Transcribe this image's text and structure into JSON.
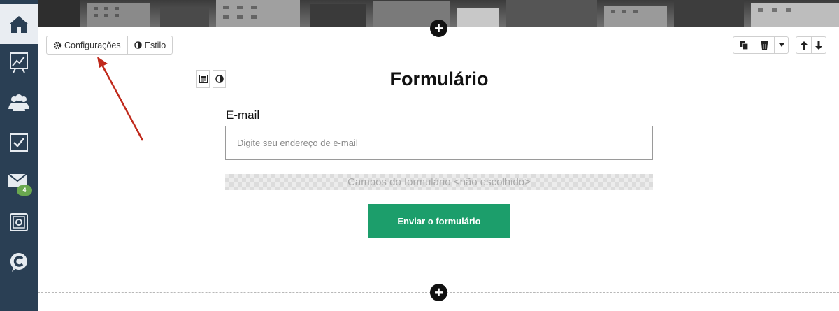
{
  "sidebar": {
    "items": [
      {
        "icon": "home-icon",
        "active": true
      },
      {
        "icon": "chart-icon"
      },
      {
        "icon": "users-icon"
      },
      {
        "icon": "checkbox-icon"
      },
      {
        "icon": "mail-icon",
        "badge": "4"
      },
      {
        "icon": "safe-icon"
      },
      {
        "icon": "chat-c-icon"
      }
    ]
  },
  "toolbar_left": {
    "settings_label": "Configurações",
    "style_label": "Estilo"
  },
  "toolbar_right": {
    "icons": [
      "copy-icon",
      "trash-icon",
      "caret-down-icon",
      "arrow-up-icon",
      "arrow-down-icon"
    ]
  },
  "form": {
    "title": "Formulário",
    "email_label": "E-mail",
    "email_placeholder": "Digite seu endereço de e-mail",
    "fields_placeholder": "Campos do formulário <não escolhido>",
    "submit_label": "Enviar o formulário"
  },
  "colors": {
    "sidebar_bg": "#2a3f54",
    "submit_bg": "#1c9e6b",
    "badge_bg": "#6aa84f",
    "arrow": "#c0291b"
  }
}
